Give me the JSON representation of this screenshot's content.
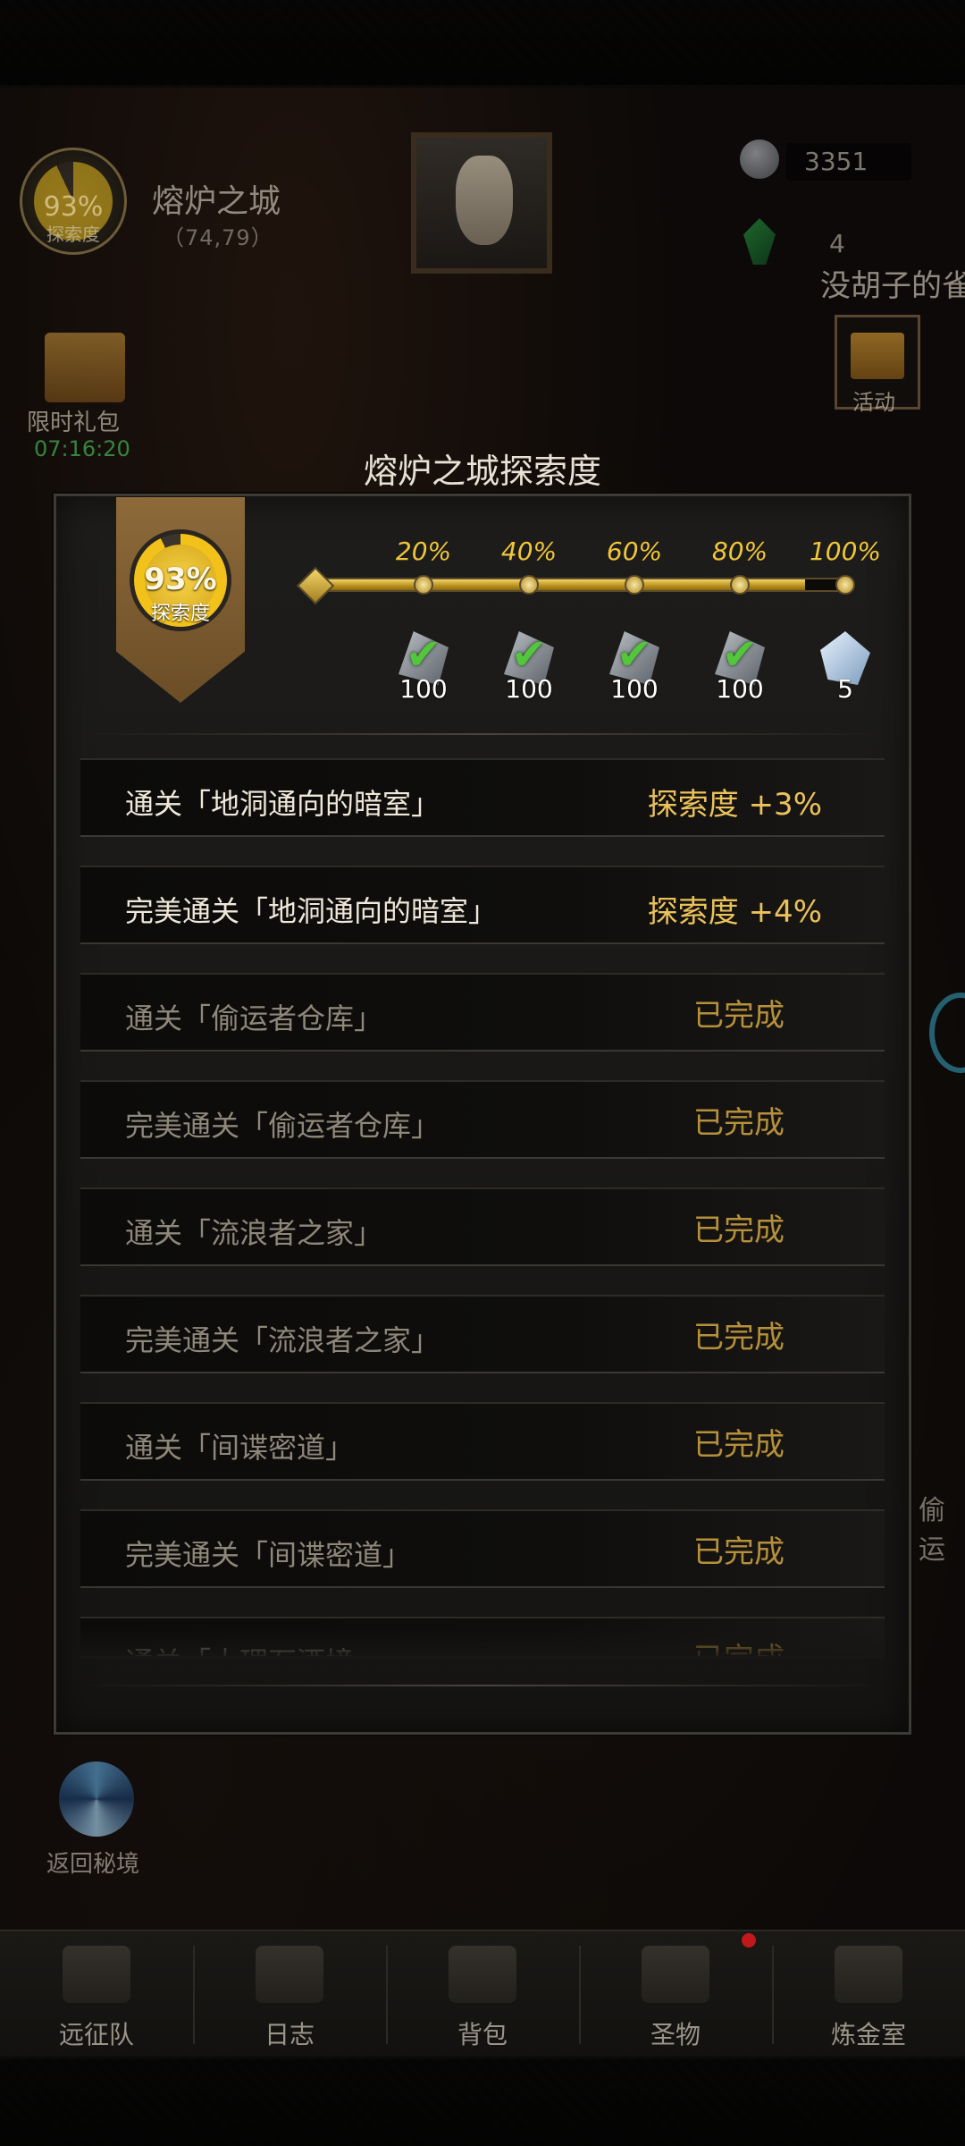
{
  "hud": {
    "explore_pct": "93%",
    "explore_label": "探索度",
    "zone_name": "熔炉之城",
    "zone_coords": "（74,79）",
    "currency_1": "3351",
    "currency_2": "4",
    "quest_text": "没胡子的雀",
    "gift_label": "限时礼包",
    "gift_timer": "07:16:20",
    "event_label": "活动",
    "portal_label": "返回秘境",
    "side_text": "偷运"
  },
  "dialog": {
    "title": "熔炉之城探索度",
    "explore_pct": "93%",
    "explore_label": "探索度",
    "explore_fraction": 0.93,
    "progress_fraction": 0.93,
    "milestones": [
      {
        "pct": "20%",
        "reward": "100",
        "claimed": true,
        "reward_type": "ore"
      },
      {
        "pct": "40%",
        "reward": "100",
        "claimed": true,
        "reward_type": "ore"
      },
      {
        "pct": "60%",
        "reward": "100",
        "claimed": true,
        "reward_type": "ore"
      },
      {
        "pct": "80%",
        "reward": "100",
        "claimed": true,
        "reward_type": "ore"
      },
      {
        "pct": "100%",
        "reward": "5",
        "claimed": false,
        "reward_type": "crystal"
      }
    ],
    "check_glyph": "✔",
    "tasks": [
      {
        "name": "通关「地洞通向的暗室」",
        "status": "探索度 +3%",
        "done": false
      },
      {
        "name": "完美通关「地洞通向的暗室」",
        "status": "探索度 +4%",
        "done": false
      },
      {
        "name": "通关「偷运者仓库」",
        "status": "已完成",
        "done": true
      },
      {
        "name": "完美通关「偷运者仓库」",
        "status": "已完成",
        "done": true
      },
      {
        "name": "通关「流浪者之家」",
        "status": "已完成",
        "done": true
      },
      {
        "name": "完美通关「流浪者之家」",
        "status": "已完成",
        "done": true
      },
      {
        "name": "通关「间谍密道」",
        "status": "已完成",
        "done": true
      },
      {
        "name": "完美通关「间谍密道」",
        "status": "已完成",
        "done": true
      },
      {
        "name": "通关「大理石酒境",
        "status": "已完成",
        "done": true
      }
    ]
  },
  "nav": {
    "items": [
      {
        "label": "远征队",
        "icon": "helmet-icon"
      },
      {
        "label": "日志",
        "icon": "journal-icon"
      },
      {
        "label": "背包",
        "icon": "backpack-icon"
      },
      {
        "label": "圣物",
        "icon": "relic-icon"
      },
      {
        "label": "炼金室",
        "icon": "alchemy-icon"
      }
    ]
  },
  "colors": {
    "gold": "#f0c63a",
    "check_green": "#53c63c",
    "done_text": "#b6903a",
    "active_text": "#ebc25a"
  }
}
